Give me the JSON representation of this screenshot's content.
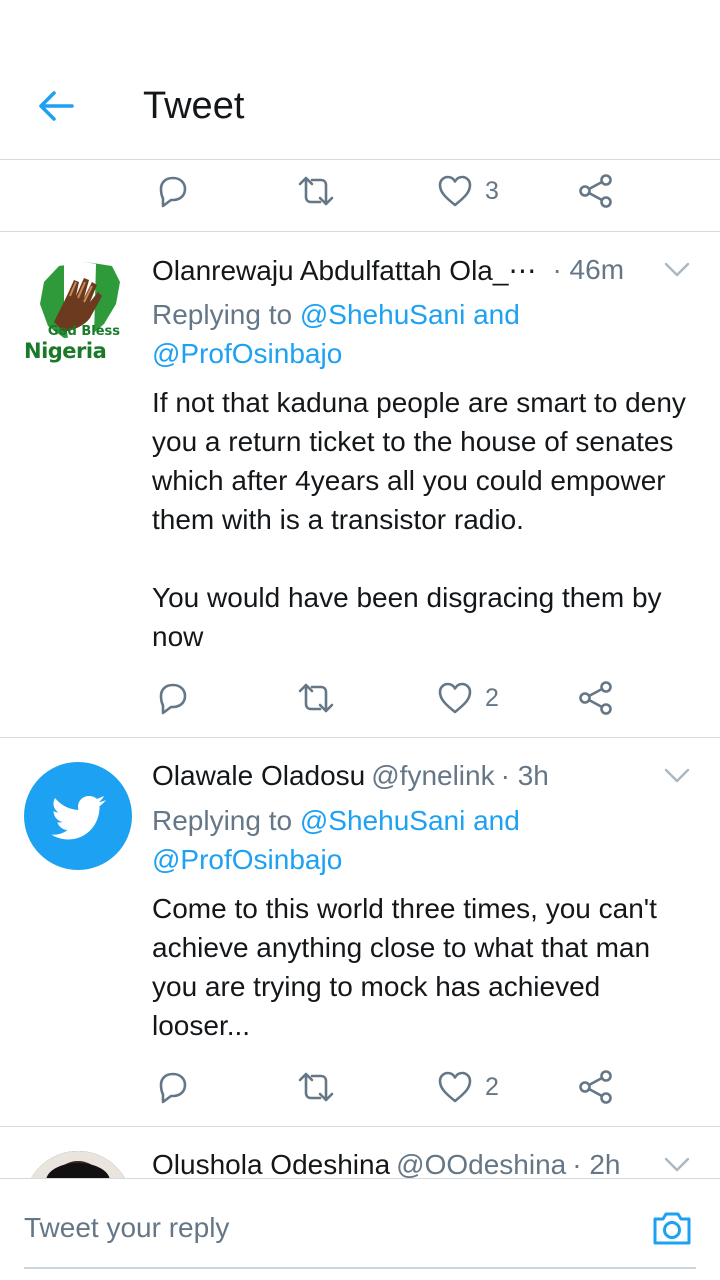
{
  "header": {
    "title": "Tweet",
    "back_icon": "arrow-left-icon"
  },
  "colors": {
    "accent": "#1da1f2",
    "text": "#14171a",
    "secondary": "#657786",
    "divider": "#d6dadd"
  },
  "top_actions": {
    "like_count": "3"
  },
  "tweets": [
    {
      "name": "Olanrewaju Abdulfattah Ola_⋯",
      "handle": "",
      "time": "· 46m",
      "replying_prefix": "Replying to ",
      "replying_mentions": "@ShehuSani and @ProfOsinbajo",
      "text": "If not that kaduna people are smart to deny you a return ticket to the house of senates which after 4years all you could empower them with is a transistor radio.\n\nYou would have been disgracing them by now",
      "like_count": "2",
      "avatar": {
        "type": "flag-logo",
        "label_top": "God Bless",
        "label_bottom": "Nigeria"
      }
    },
    {
      "name": "Olawale Oladosu",
      "handle": "@fynelink",
      "time": "· 3h",
      "replying_prefix": "Replying to ",
      "replying_mentions": "@ShehuSani and @ProfOsinbajo",
      "text": "Come to this world three times, you can't achieve anything close to what that man you are trying to mock has achieved looser...",
      "like_count": "2",
      "avatar": {
        "type": "twitter-bird-icon"
      }
    },
    {
      "name": "Olushola Odeshina",
      "handle": "@OOdeshina",
      "time": "· 2h",
      "avatar": {
        "type": "photo"
      }
    }
  ],
  "composer": {
    "placeholder": "Tweet your reply",
    "camera_icon": "camera-icon"
  }
}
